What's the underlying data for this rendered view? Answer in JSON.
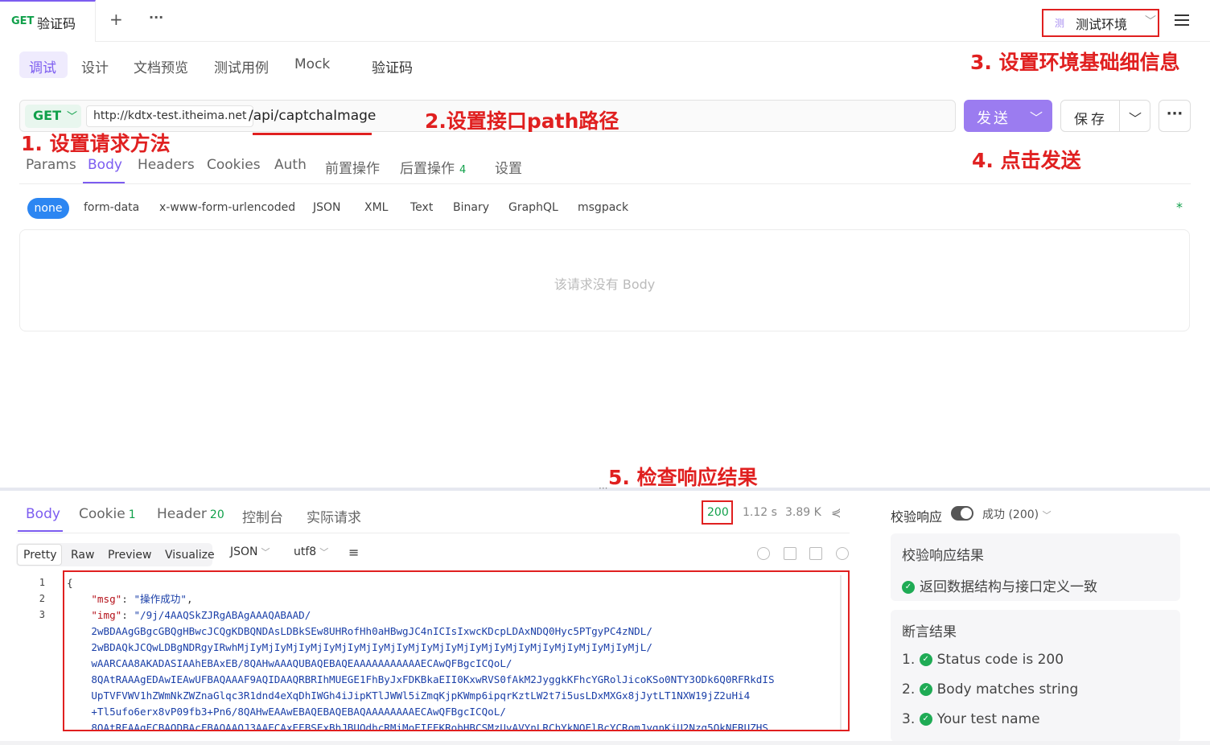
{
  "tab": {
    "method": "GET",
    "title": "验证码",
    "add_icon": "+",
    "more_icon": "···"
  },
  "environment": {
    "badge": "测",
    "label": "测试环境",
    "chevron": "﹀"
  },
  "subtabs": [
    "调试",
    "设计",
    "文档预览",
    "测试用例",
    "Mock",
    "验证码"
  ],
  "request": {
    "method": "GET",
    "base_url": "http://kdtx-test.itheima.net",
    "path": "/api/captchaImage",
    "send_label": "发送",
    "save_label": "保存",
    "more_label": "···"
  },
  "annotations": {
    "a1": "1. 设置请求方法",
    "a2": "2.设置接口path路径",
    "a3": "3. 设置环境基础细信息",
    "a4": "4. 点击发送",
    "a5": "5. 检查响应结果"
  },
  "request_tabs": {
    "params": "Params",
    "body": "Body",
    "headers": "Headers",
    "cookies": "Cookies",
    "auth": "Auth",
    "pre": "前置操作",
    "post": "后置操作",
    "post_count": "4",
    "settings": "设置"
  },
  "body_types": [
    "none",
    "form-data",
    "x-www-form-urlencoded",
    "JSON",
    "XML",
    "Text",
    "Binary",
    "GraphQL",
    "msgpack"
  ],
  "body_required_mark": "*",
  "body_empty_text": "该请求没有 Body",
  "response_tabs": {
    "body": "Body",
    "cookie": "Cookie",
    "cookie_count": "1",
    "header": "Header",
    "header_count": "20",
    "console": "控制台",
    "actual": "实际请求"
  },
  "response_meta": {
    "status": "200",
    "time": "1.12 s",
    "size": "3.89 K"
  },
  "view_modes": [
    "Pretty",
    "Raw",
    "Preview",
    "Visualize"
  ],
  "format": "JSON",
  "encoding": "utf8",
  "code": {
    "line_numbers": [
      "1",
      "2",
      "3"
    ],
    "open_brace": "{",
    "msg_key": "\"msg\"",
    "msg_value": "\"操作成功\"",
    "img_key": "\"img\"",
    "img_lines": [
      "\"/9j/4AAQSkZJRgABAgAAAQABAAD/",
      "2wBDAAgGBgcGBQgHBwcJCQgKDBQNDAsLDBkSEw8UHRofHh0aHBwgJC4nICIsIxwcKDcpLDAxNDQ0Hyc5PTgyPC4zNDL/",
      "2wBDAQkJCQwLDBgNDRgyIRwhMjIyMjIyMjIyMjIyMjIyMjIyMjIyMjIyMjIyMjIyMjIyMjIyMjIyMjIyMjIyMjIyMjL/",
      "wAARCAA8AKADASIAAhEBAxEB/8QAHwAAAQUBAQEBAQEAAAAAAAAAAAECAwQFBgcICQoL/",
      "8QAtRAAAgEDAwIEAwUFBAQAAAF9AQIDAAQRBRIhMUEGE1FhByJxFDKBkaEII0KxwRVS0fAkM2JyggkKFhcYGRolJicoKSo0NTY3ODk6Q0RFRkdIS",
      "UpTVFVWV1hZWmNkZWZnaGlqc3R1dnd4eXqDhIWGh4iJipKTlJWWl5iZmqKjpKWmp6ipqrKztLW2t7i5usLDxMXGx8jJytLT1NXW19jZ2uHi4",
      "+Tl5ufo6erx8vP09fb3+Pn6/8QAHwEAAwEBAQEBAQEBAQAAAAAAAAECAwQFBgcICQoL/",
      "8QAtREAAgECBAQDBAcFBAQAAQJ3AAECAxEEBSExBhJBUQdhcRMiMoEIFEKRobHBCSMzUvAVYnLRChYkNOElBcYCRomJygnKjU2Nzg5OkNERUZHS"
    ]
  },
  "right_panel": {
    "title": "校验响应",
    "status_text": "成功 (200)",
    "card1_title": "校验响应结果",
    "card1_line": "返回数据结构与接口定义一致",
    "card2_title": "断言结果",
    "assertions": [
      "1.",
      "Status code is 200",
      "2.",
      "Body matches string",
      "3.",
      "Your test name"
    ]
  },
  "colors": {
    "accent": "#7c5cf0",
    "success": "#10a04a",
    "annotation": "#e02020",
    "send": "#9b7cf0"
  }
}
